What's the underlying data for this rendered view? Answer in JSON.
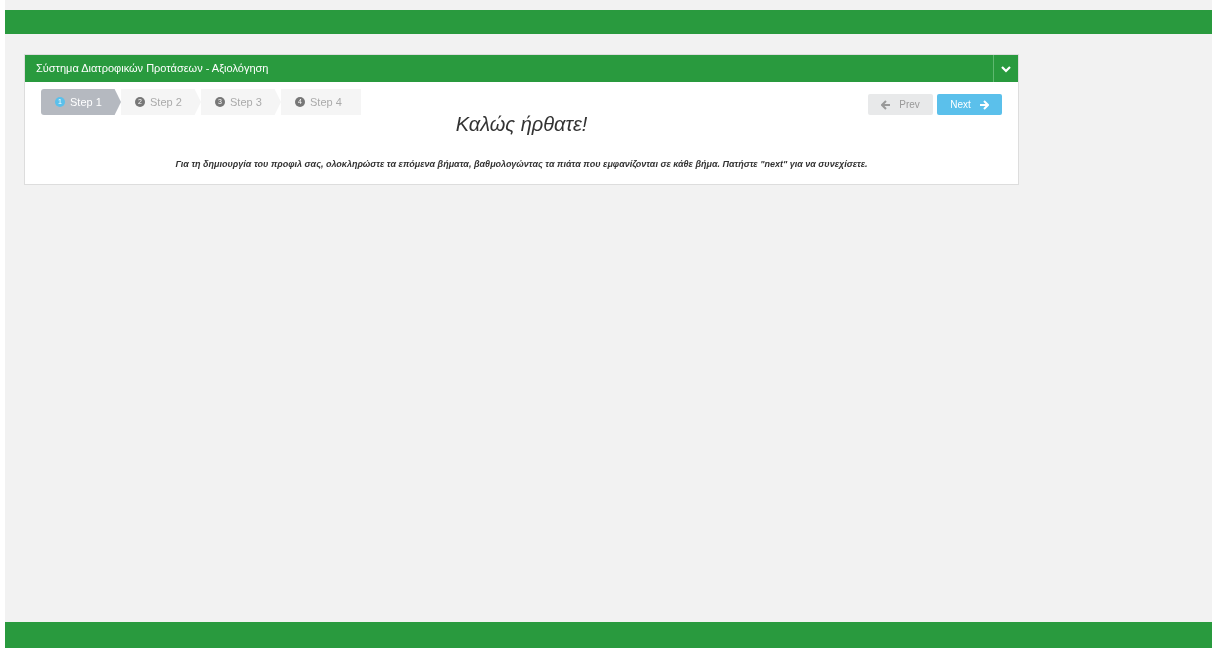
{
  "panel": {
    "title": "Σύστημα Διατροφικών Προτάσεων - Αξιολόγηση"
  },
  "steps": [
    {
      "number": "1",
      "label": "Step 1",
      "selected": true
    },
    {
      "number": "2",
      "label": "Step 2",
      "selected": false
    },
    {
      "number": "3",
      "label": "Step 3",
      "selected": false
    },
    {
      "number": "4",
      "label": "Step 4",
      "selected": false
    }
  ],
  "buttons": [
    {
      "label": "Prev",
      "kind": "prev",
      "disabled": true
    },
    {
      "label": "Next",
      "kind": "next",
      "disabled": false
    }
  ],
  "heading": "Καλώς ήρθατε!",
  "intro": "Για τη δημιουργία του προφιλ σας, ολοκληρώστε τα επόμενα βήματα, βαθμολογώντας τα πιάτα που εμφανίζονται σε κάθε βήμα. Πατήστε \"next\" για να συνεχίσετε."
}
